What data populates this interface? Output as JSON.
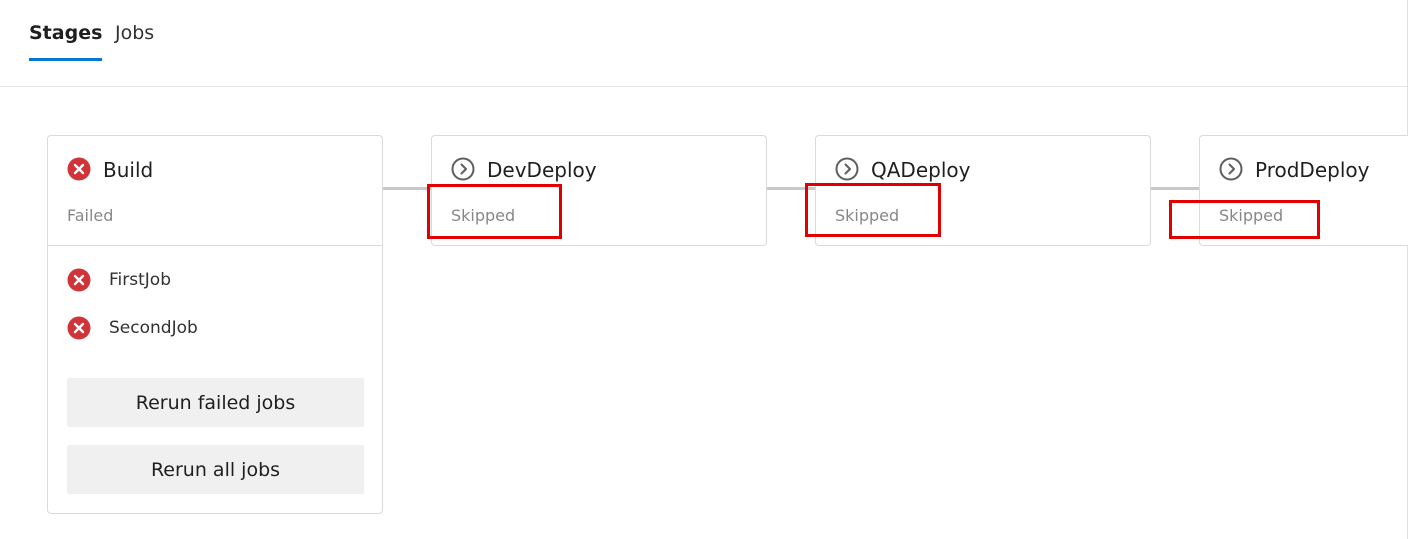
{
  "tabs": [
    {
      "label": "Stages",
      "active": true
    },
    {
      "label": "Jobs",
      "active": false
    }
  ],
  "stages": [
    {
      "name": "Build",
      "status": "Failed",
      "icon": "error-circle-icon",
      "jobs": [
        {
          "name": "FirstJob",
          "icon": "error-circle-icon"
        },
        {
          "name": "SecondJob",
          "icon": "error-circle-icon"
        }
      ],
      "actions": [
        "Rerun failed jobs",
        "Rerun all jobs"
      ]
    },
    {
      "name": "DevDeploy",
      "status": "Skipped",
      "icon": "skipped-chevron-icon"
    },
    {
      "name": "QADeploy",
      "status": "Skipped",
      "icon": "skipped-chevron-icon"
    },
    {
      "name": "ProdDeploy",
      "status": "Skipped",
      "icon": "skipped-chevron-icon"
    }
  ],
  "colors": {
    "accent": "#0078d4",
    "error": "#d13438",
    "skipped_icon": "#605e5c",
    "annotation": "#e00000"
  }
}
